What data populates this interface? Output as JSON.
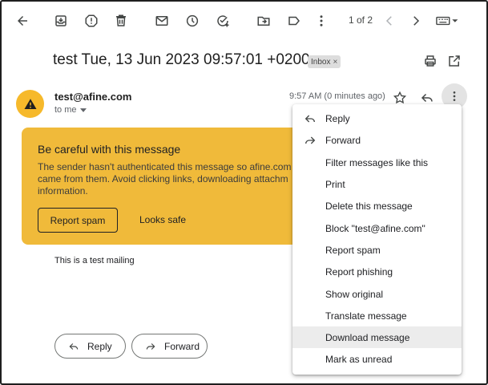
{
  "toolbar": {
    "icons": [
      "back-icon",
      "archive-icon",
      "report-spam-icon",
      "delete-icon",
      "mark-unread-icon",
      "snooze-icon",
      "add-task-icon",
      "move-to-icon",
      "label-icon",
      "more-vert-icon",
      "chevron-left-icon",
      "chevron-right-icon",
      "keyboard-icon"
    ],
    "pager": "1 of 2"
  },
  "email": {
    "subject": "test Tue, 13 Jun 2023 09:57:01 +0200",
    "label_chip": "Inbox",
    "label_remove": "×",
    "sender": "test@afine.com",
    "recipient": "to me",
    "time": "9:57 AM (0 minutes ago)",
    "body": "This is a test mailing"
  },
  "warning": {
    "title": "Be careful with this message",
    "line1": "The sender hasn't authenticated this message so afine.com",
    "line2": "came from them. Avoid clicking links, downloading attachm",
    "line3": "information.",
    "report_spam": "Report spam",
    "looks_safe": "Looks safe",
    "color": "#f0ba3a"
  },
  "actions": {
    "reply": "Reply",
    "forward": "Forward"
  },
  "menu": {
    "items": [
      {
        "label": "Reply",
        "icon": "reply-icon"
      },
      {
        "label": "Forward",
        "icon": "forward-icon"
      },
      {
        "label": "Filter messages like this"
      },
      {
        "label": "Print"
      },
      {
        "label": "Delete this message"
      },
      {
        "label": "Block \"test@afine.com\""
      },
      {
        "label": "Report spam"
      },
      {
        "label": "Report phishing"
      },
      {
        "label": "Show original"
      },
      {
        "label": "Translate message"
      },
      {
        "label": "Download message",
        "highlighted": true
      },
      {
        "label": "Mark as unread"
      }
    ]
  }
}
